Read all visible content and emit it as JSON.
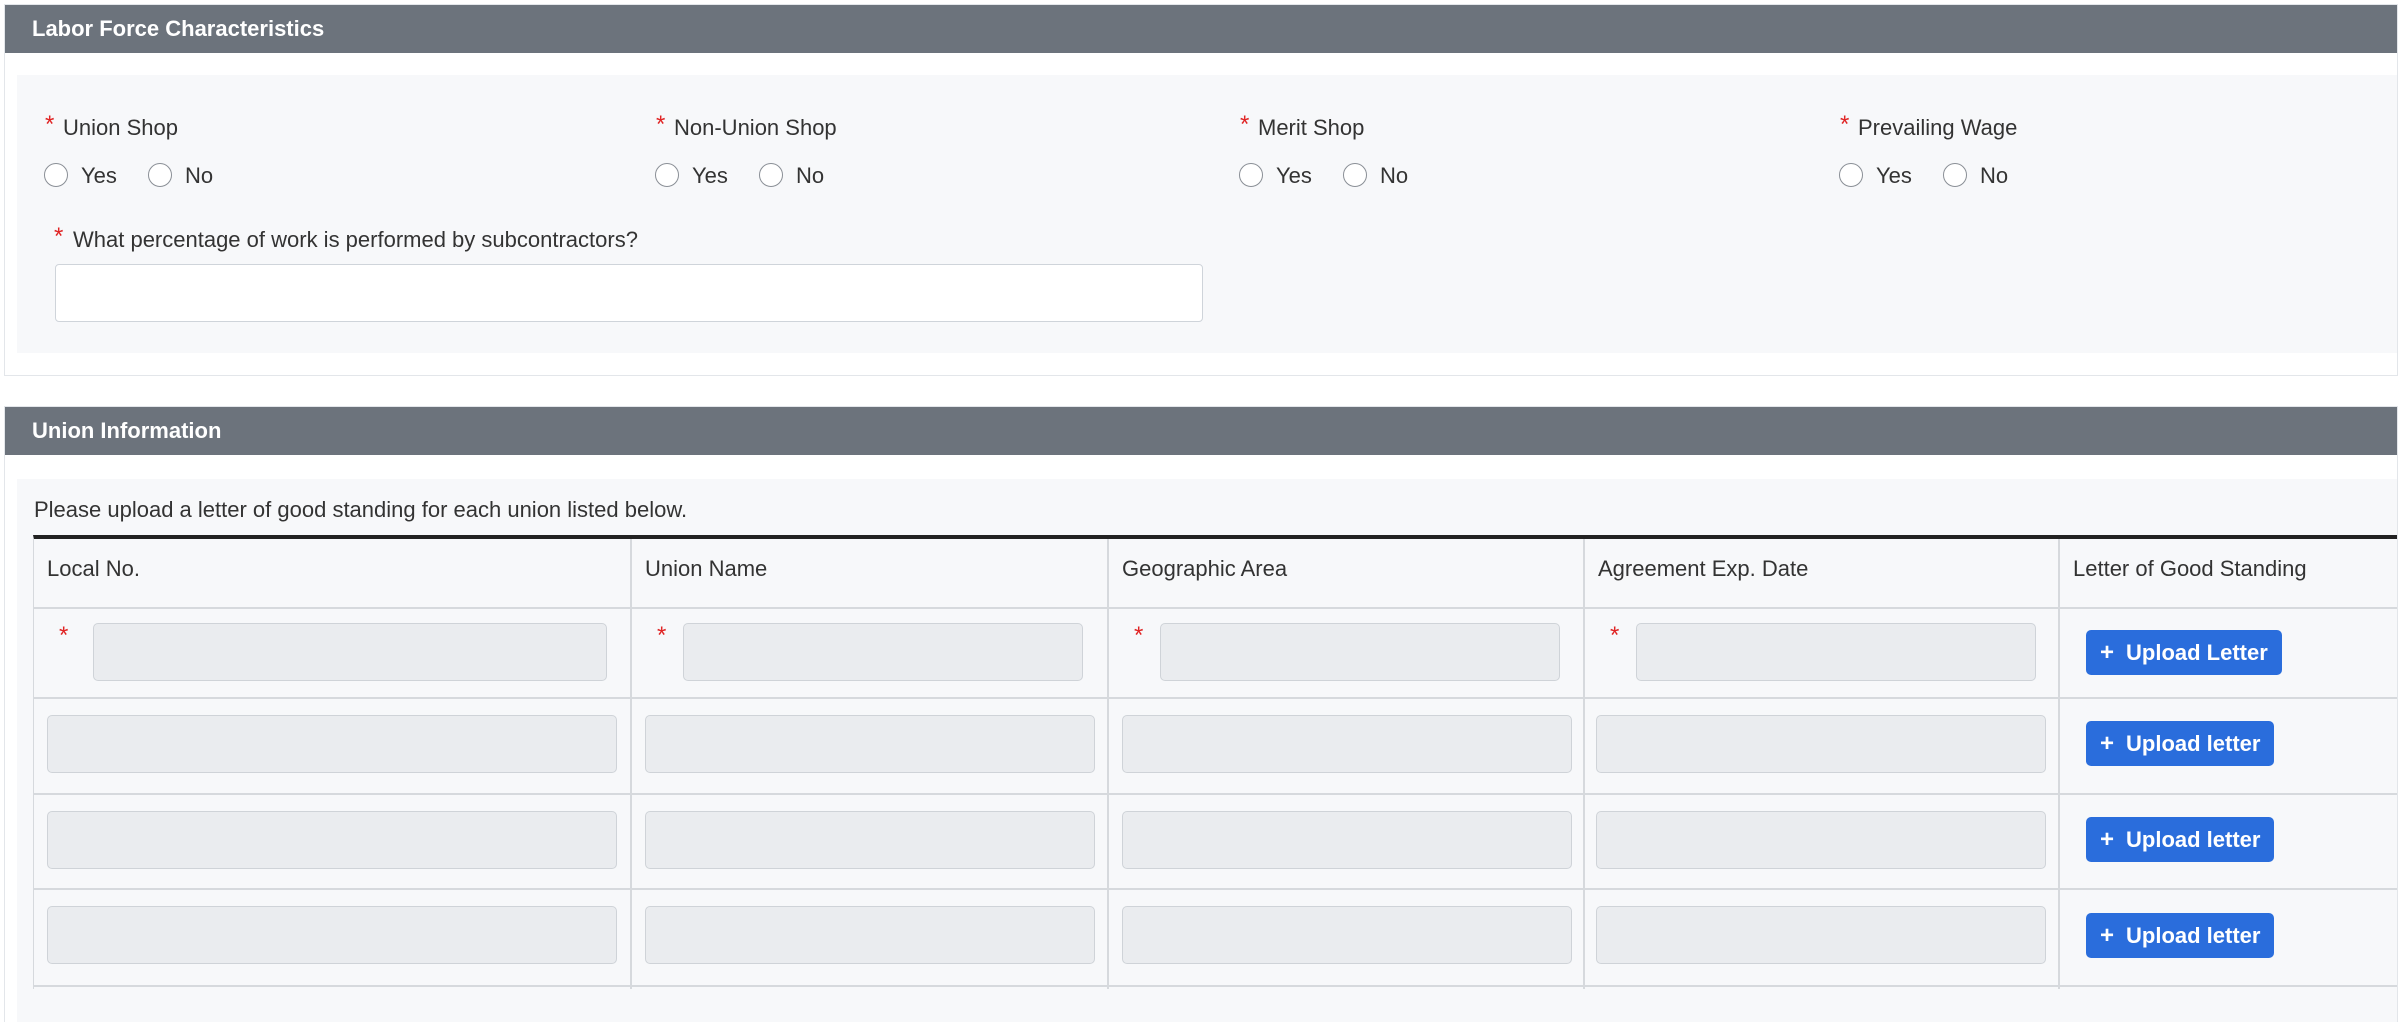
{
  "labor_panel": {
    "title": "Labor Force Characteristics",
    "required_mark": "*",
    "questions": [
      {
        "label": "Union Shop",
        "yes": "Yes",
        "no": "No"
      },
      {
        "label": "Non-Union Shop",
        "yes": "Yes",
        "no": "No"
      },
      {
        "label": "Merit Shop",
        "yes": "Yes",
        "no": "No"
      },
      {
        "label": "Prevailing Wage",
        "yes": "Yes",
        "no": "No"
      }
    ],
    "subcontractor_question": "What percentage of work is performed by subcontractors?",
    "subcontractor_value": ""
  },
  "union_panel": {
    "title": "Union Information",
    "instruction": "Please upload a letter of good standing for each union listed below.",
    "columns": [
      "Local No.",
      "Union Name",
      "Geographic Area",
      "Agreement Exp. Date",
      "Letter of Good Standing"
    ],
    "rows": [
      {
        "local_no": "",
        "union_name": "",
        "geographic_area": "",
        "agreement_exp_date": "",
        "upload_label": "Upload Letter",
        "required": true
      },
      {
        "local_no": "",
        "union_name": "",
        "geographic_area": "",
        "agreement_exp_date": "",
        "upload_label": "Upload letter",
        "required": false
      },
      {
        "local_no": "",
        "union_name": "",
        "geographic_area": "",
        "agreement_exp_date": "",
        "upload_label": "Upload letter",
        "required": false
      },
      {
        "local_no": "",
        "union_name": "",
        "geographic_area": "",
        "agreement_exp_date": "",
        "upload_label": "Upload letter",
        "required": false
      }
    ],
    "plus_glyph": "+"
  },
  "colors": {
    "header_bg": "#6c737c",
    "button_bg": "#2a6ddc",
    "required": "#e02424"
  }
}
